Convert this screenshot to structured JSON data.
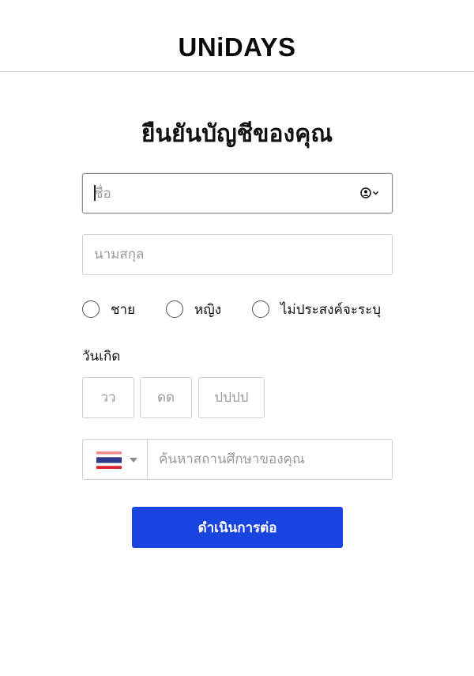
{
  "header": {
    "logo_text": "UNiDAYS"
  },
  "page_title": "ยืนยันบัญชีของคุณ",
  "first_name": {
    "placeholder": "ชื่อ",
    "value": ""
  },
  "last_name": {
    "placeholder": "นามสกุล",
    "value": ""
  },
  "gender_options": [
    {
      "label": "ชาย",
      "selected": false
    },
    {
      "label": "หญิง",
      "selected": false
    },
    {
      "label": "ไม่ประสงค์จะระบุ",
      "selected": false
    }
  ],
  "dob": {
    "label": "วันเกิด",
    "day_placeholder": "วว",
    "month_placeholder": "ดด",
    "year_placeholder": "ปปปป"
  },
  "country": {
    "selected": "Thailand",
    "flag_icon": "thailand-flag-icon"
  },
  "school": {
    "placeholder": "ค้นหาสถานศึกษาของคุณ",
    "value": ""
  },
  "continue_button": {
    "label": "ดำเนินการต่อ",
    "color": "#1a44e0"
  }
}
